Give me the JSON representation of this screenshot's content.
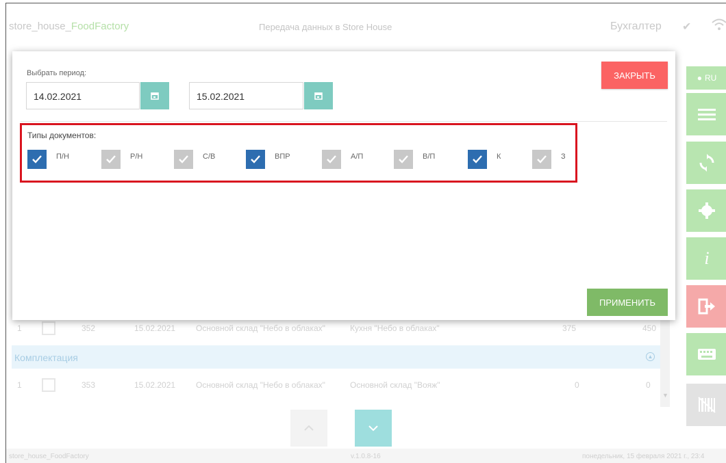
{
  "header": {
    "app_title_prefix": "store_house_",
    "app_title_brand": "FoodFactory",
    "center_title": "Передача данных в Store House",
    "role": "Бухгалтер"
  },
  "sidebar": {
    "lang_label": "RU"
  },
  "modal": {
    "period_label": "Выбрать период:",
    "date_from": "14.02.2021",
    "date_to": "15.02.2021",
    "close_label": "ЗАКРЫТЬ",
    "doc_types_label": "Типы документов:",
    "doc_types": [
      {
        "label": "П/Н",
        "checked": true
      },
      {
        "label": "Р/Н",
        "checked": false
      },
      {
        "label": "С/В",
        "checked": false
      },
      {
        "label": "ВПР",
        "checked": true
      },
      {
        "label": "А/П",
        "checked": false
      },
      {
        "label": "В/П",
        "checked": false
      },
      {
        "label": "К",
        "checked": true
      },
      {
        "label": "З",
        "checked": false
      }
    ],
    "apply_label": "ПРИМЕНИТЬ"
  },
  "table": {
    "rows": [
      {
        "num": "1",
        "id": "352",
        "date": "15.02.2021",
        "from": "Основной склад \"Небо в облаках\"",
        "to": "Кухня \"Небо в облаках\"",
        "qty": "375",
        "sum": "450"
      },
      {
        "num": "1",
        "id": "353",
        "date": "15.02.2021",
        "from": "Основной склад \"Небо в облаках\"",
        "to": "Основной склад \"Вояж\"",
        "qty": "0",
        "sum": "0"
      }
    ],
    "section_label": "Комплектация"
  },
  "footer": {
    "left": "store_house_FoodFactory",
    "center": "v.1.0.8-16",
    "right": "понедельник, 15 февраля 2021 г., 23:4"
  },
  "colors": {
    "checked": "#2d6db0",
    "unchecked": "#c8c8c8",
    "close": "#fb6363",
    "apply": "#7fba67",
    "calendar": "#7ecbc0",
    "highlight": "#d9141f"
  }
}
